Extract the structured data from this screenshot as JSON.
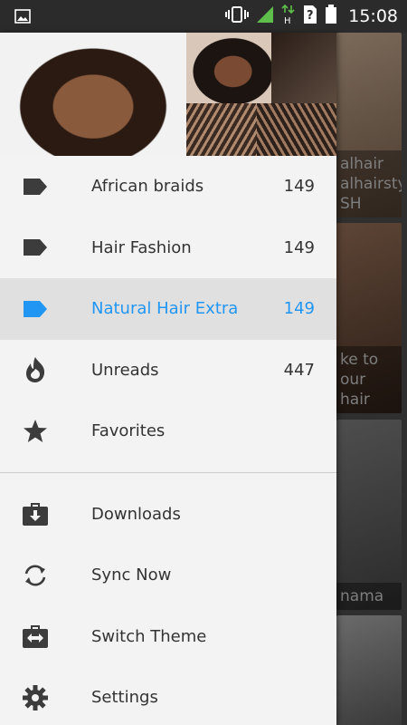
{
  "status_bar": {
    "time": "15:08",
    "icons": [
      "image-icon",
      "vibrate-icon",
      "signal-icon",
      "data-h-icon",
      "sim-unknown-icon",
      "battery-icon"
    ]
  },
  "background_captions": [
    "alhair\nalhairsty\nSH",
    "ke to\nour\nhair",
    "nama"
  ],
  "drawer": {
    "header_image": "braided hairstyles collage",
    "categories": [
      {
        "label": "African braids",
        "count": "149",
        "icon": "label-icon",
        "active": false
      },
      {
        "label": "Hair Fashion",
        "count": "149",
        "icon": "label-icon",
        "active": false
      },
      {
        "label": "Natural Hair Extra",
        "count": "149",
        "icon": "label-icon",
        "active": true
      },
      {
        "label": "Unreads",
        "count": "447",
        "icon": "flame-icon",
        "active": false
      },
      {
        "label": "Favorites",
        "count": "",
        "icon": "star-icon",
        "active": false
      }
    ],
    "actions": [
      {
        "label": "Downloads",
        "icon": "download-box-icon"
      },
      {
        "label": "Sync Now",
        "icon": "sync-icon"
      },
      {
        "label": "Switch Theme",
        "icon": "switch-theme-icon"
      },
      {
        "label": "Settings",
        "icon": "gear-icon"
      }
    ],
    "active_color": "#2196f3",
    "icon_color": "#3c3c3c"
  }
}
